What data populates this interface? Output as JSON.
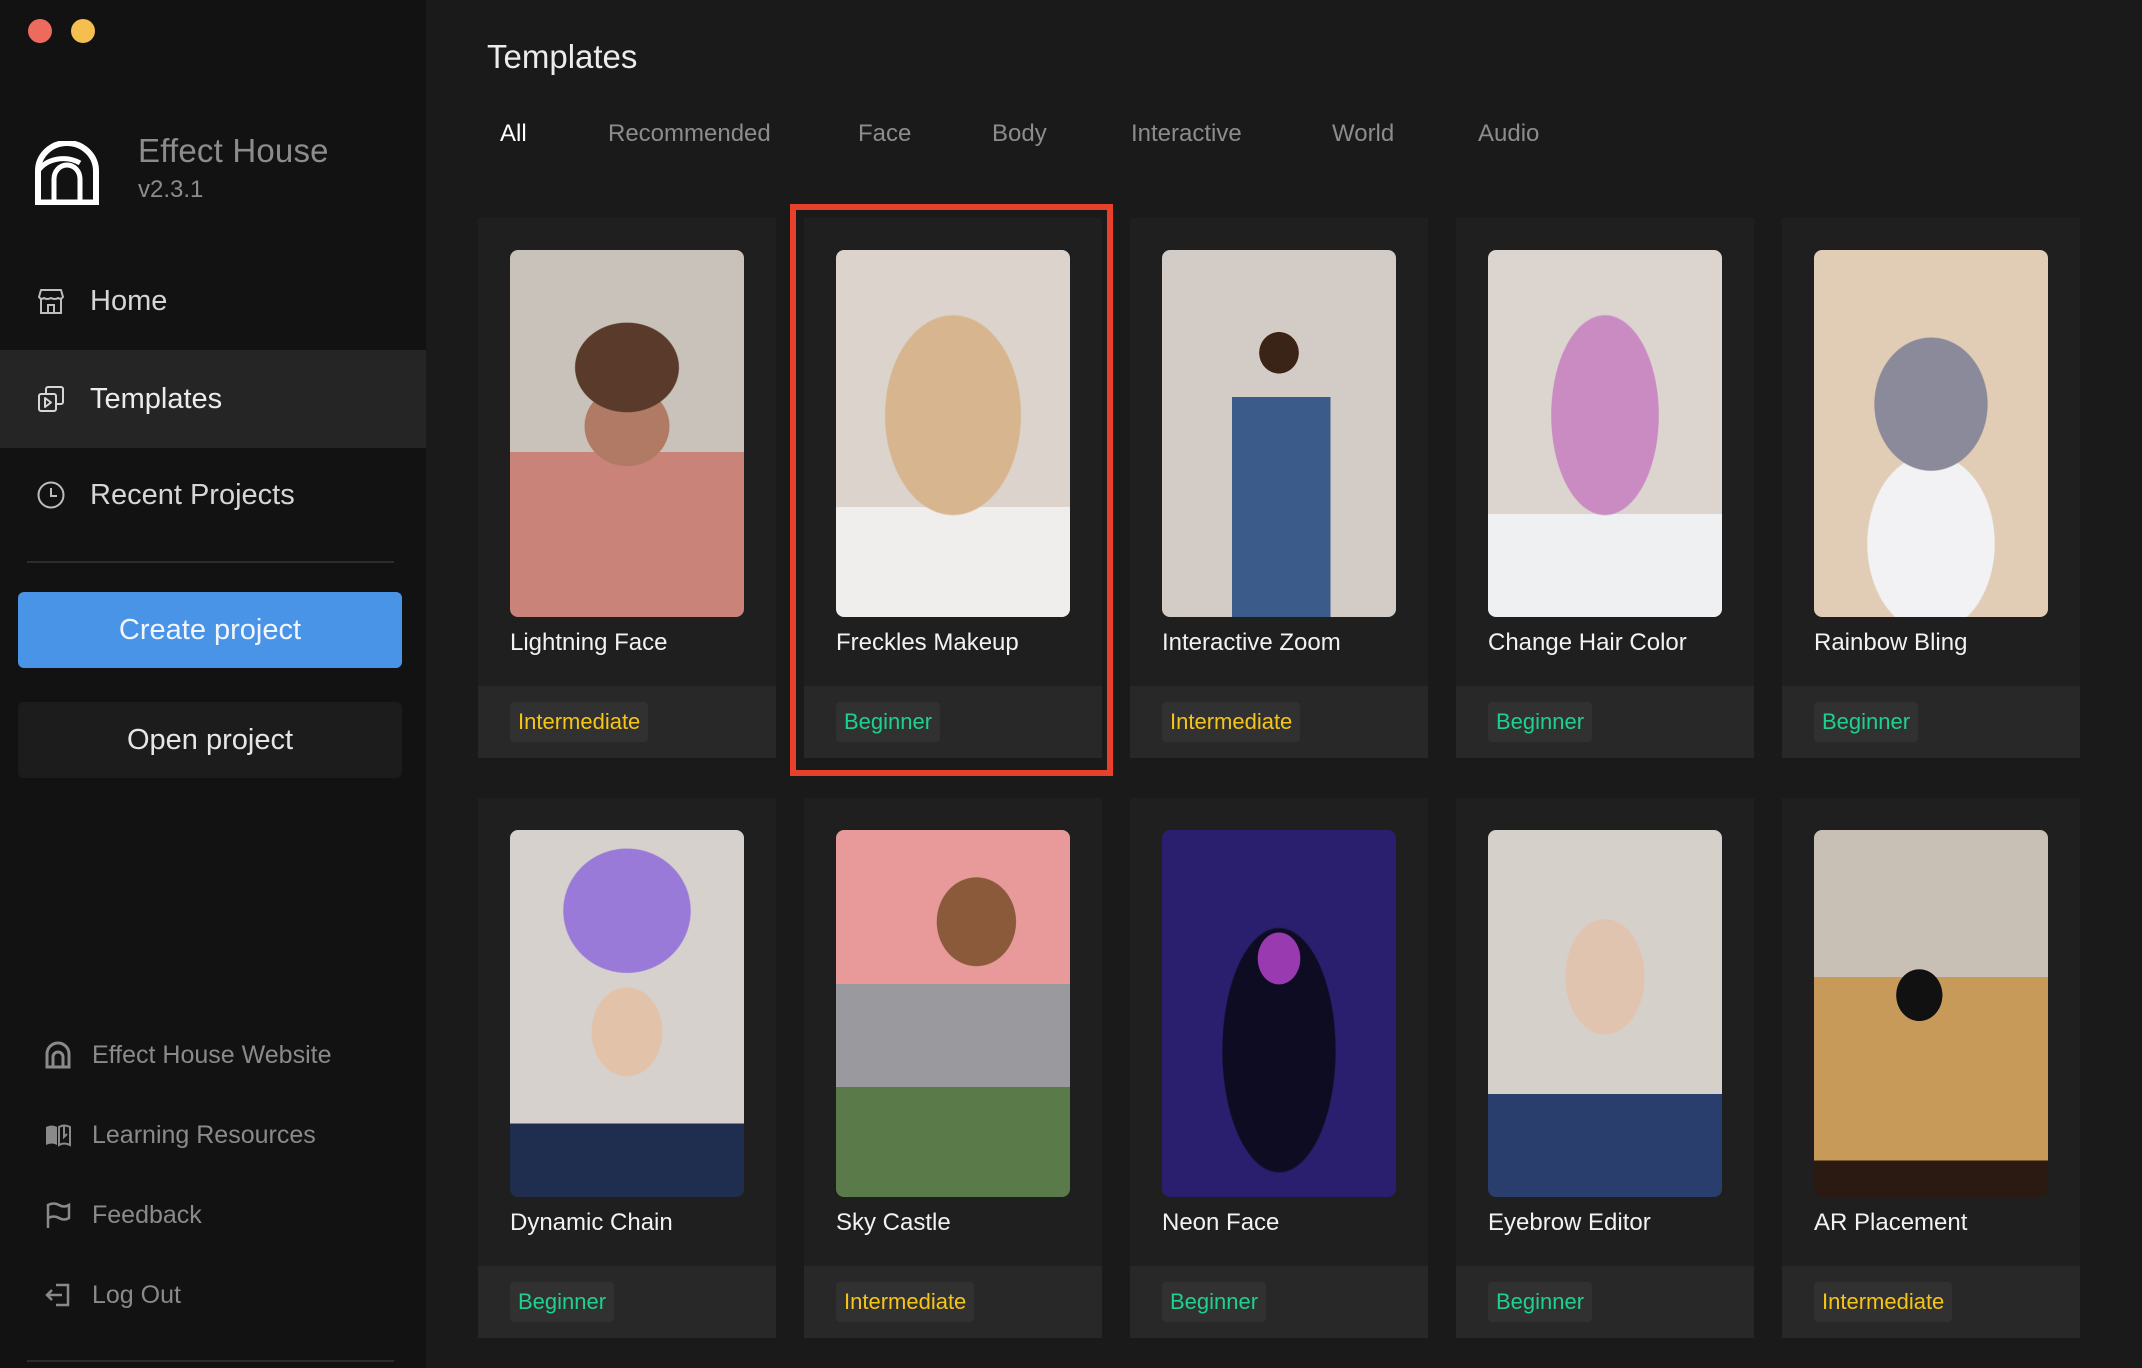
{
  "window": {
    "controls": [
      "close",
      "minimize"
    ],
    "colors": {
      "close": "#ec6a5e",
      "minimize": "#f4bf4f"
    }
  },
  "sidebar": {
    "brand": {
      "name": "Effect House",
      "version": "v2.3.1",
      "icon": "effect-house-logo"
    },
    "nav": [
      {
        "label": "Home",
        "icon": "store-icon",
        "active": false
      },
      {
        "label": "Templates",
        "icon": "templates-icon",
        "active": true
      },
      {
        "label": "Recent Projects",
        "icon": "clock-icon",
        "active": false
      }
    ],
    "actions": {
      "create_label": "Create project",
      "open_label": "Open project"
    },
    "links": [
      {
        "label": "Effect House Website",
        "icon": "effect-house-icon"
      },
      {
        "label": "Learning Resources",
        "icon": "book-icon"
      },
      {
        "label": "Feedback",
        "icon": "flag-icon"
      },
      {
        "label": "Log Out",
        "icon": "logout-icon"
      }
    ]
  },
  "main": {
    "title": "Templates",
    "tabs": [
      {
        "label": "All",
        "active": true
      },
      {
        "label": "Recommended",
        "active": false
      },
      {
        "label": "Face",
        "active": false
      },
      {
        "label": "Body",
        "active": false
      },
      {
        "label": "Interactive",
        "active": false
      },
      {
        "label": "World",
        "active": false
      },
      {
        "label": "Audio",
        "active": false
      }
    ],
    "templates": [
      {
        "title": "Lightning Face",
        "level": "Intermediate",
        "highlighted": false
      },
      {
        "title": "Freckles Makeup",
        "level": "Beginner",
        "highlighted": true
      },
      {
        "title": "Interactive Zoom",
        "level": "Intermediate",
        "highlighted": false
      },
      {
        "title": "Change Hair Color",
        "level": "Beginner",
        "highlighted": false
      },
      {
        "title": "Rainbow Bling",
        "level": "Beginner",
        "highlighted": false
      },
      {
        "title": "Dynamic Chain",
        "level": "Beginner",
        "highlighted": false
      },
      {
        "title": "Sky Castle",
        "level": "Intermediate",
        "highlighted": false
      },
      {
        "title": "Neon Face",
        "level": "Beginner",
        "highlighted": false
      },
      {
        "title": "Eyebrow Editor",
        "level": "Beginner",
        "highlighted": false
      },
      {
        "title": "AR Placement",
        "level": "Intermediate",
        "highlighted": false
      }
    ],
    "level_colors": {
      "Beginner": "#1fd18f",
      "Intermediate": "#f5c518"
    },
    "highlight_color": "#e8402a"
  },
  "theme": {
    "accent": "#4a94e8",
    "sidebar_bg": "#121212",
    "main_bg": "#1a1a1a",
    "card_bg": "#1f1f1f"
  }
}
